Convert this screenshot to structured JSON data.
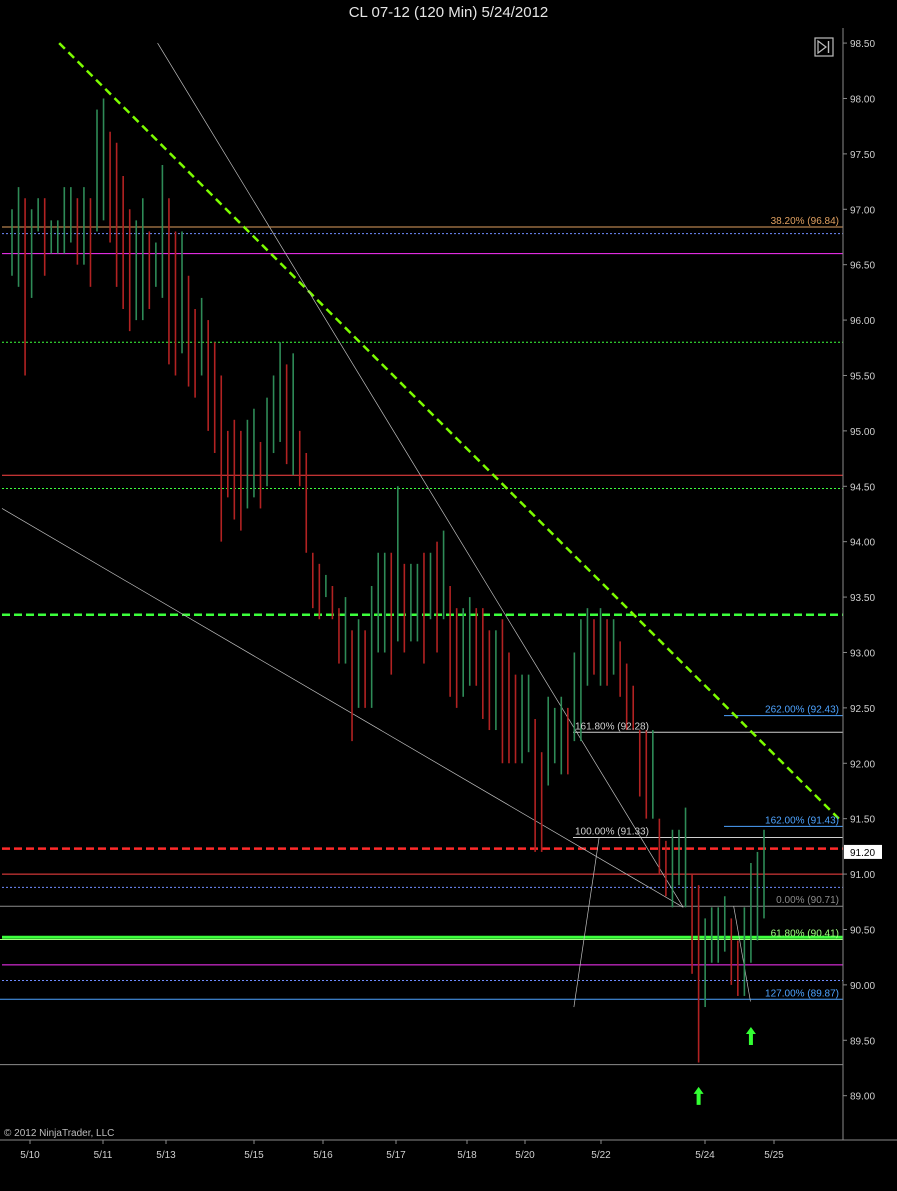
{
  "window": {
    "title": "CL 07-12 (120 Min)  5/24/2012",
    "copyright": "© 2012 NinjaTrader, LLC"
  },
  "colors": {
    "background": "#000000",
    "up_bar": "#2e8b57",
    "down_bar": "#b22222",
    "axis_text": "#cfcfcf",
    "grid": "#3a3a3a",
    "trend_green": "#7cfc00",
    "trend_gray": "#bfbfbf",
    "support_red": "#ff2a2a",
    "support_green": "#3cff3c",
    "fib_blue": "#4da3ff",
    "fib_orange": "#e0a060",
    "fib_white": "#d0d0d0",
    "fib_green": "#a0ff80",
    "magenta": "#ff33ff",
    "arrow_green": "#33ff33",
    "price_label_bg": "#ffffff"
  },
  "chart_data": {
    "type": "ohlc",
    "title": "CL 07-12 (120 Min)  5/24/2012",
    "xlabel": "",
    "ylabel": "",
    "ylim": [
      88.6,
      98.6
    ],
    "y_ticks": [
      "98.50",
      "98.00",
      "97.50",
      "97.00",
      "96.50",
      "96.00",
      "95.50",
      "95.00",
      "94.50",
      "94.00",
      "93.50",
      "93.00",
      "92.50",
      "92.00",
      "91.50",
      "91.00",
      "90.50",
      "90.00",
      "89.50",
      "89.00"
    ],
    "x_ticks": [
      "5/10",
      "5/11",
      "5/13",
      "5/15",
      "5/16",
      "5/17",
      "5/18",
      "5/20",
      "5/22",
      "5/24",
      "5/25"
    ],
    "last_price": "91.20",
    "grid": false,
    "bars": {
      "lows": [
        96.4,
        96.3,
        95.5,
        96.2,
        96.8,
        96.4,
        96.6,
        96.6,
        96.6,
        96.7,
        96.5,
        96.5,
        96.3,
        96.8,
        96.9,
        96.7,
        96.3,
        96.1,
        95.9,
        96.0,
        96.0,
        96.1,
        96.3,
        96.2,
        95.6,
        95.5,
        95.7,
        95.4,
        95.3,
        95.5,
        95.0,
        94.8,
        94.0,
        94.4,
        94.2,
        94.1,
        94.3,
        94.4,
        94.3,
        94.5,
        94.8,
        94.9,
        94.7,
        94.6,
        94.5,
        93.9,
        93.4,
        93.3,
        93.5,
        93.3,
        92.9,
        92.9,
        92.2,
        92.5,
        92.5,
        92.5,
        93.0,
        93.0,
        92.8,
        93.1,
        93.0,
        93.1,
        93.1,
        92.9,
        93.3,
        93.0,
        93.3,
        92.6,
        92.5,
        92.6,
        92.7,
        92.7,
        92.4,
        92.3,
        92.3,
        92.0,
        92.0,
        92.0,
        92.0,
        92.1,
        91.2,
        91.2,
        91.8,
        92.0,
        91.9,
        91.9,
        92.2,
        92.2,
        92.7,
        92.8,
        92.7,
        92.7,
        92.8,
        92.6,
        92.3,
        92.3,
        92.3,
        92.3,
        92.3,
        91.0,
        90.8,
        90.7,
        90.9,
        90.7,
        90.1,
        89.3,
        89.8,
        90.2,
        90.2,
        90.3,
        90.0,
        89.9,
        89.9,
        90.2,
        90.4,
        90.6
      ],
      "highs": [
        97.0,
        97.2,
        97.1,
        97.0,
        97.1,
        97.1,
        96.9,
        96.9,
        97.2,
        97.2,
        97.1,
        97.2,
        97.1,
        97.9,
        98.0,
        97.7,
        97.6,
        97.3,
        97.0,
        96.9,
        97.1,
        96.8,
        96.7,
        97.4,
        97.1,
        96.8,
        96.8,
        96.4,
        96.1,
        96.2,
        96.0,
        95.8,
        95.5,
        95.0,
        95.1,
        95.0,
        95.1,
        95.2,
        94.9,
        95.3,
        95.5,
        95.8,
        95.6,
        95.7,
        95.0,
        94.8,
        93.9,
        93.8,
        93.7,
        93.6,
        93.4,
        93.5,
        93.2,
        93.3,
        93.2,
        93.6,
        93.9,
        93.9,
        93.9,
        94.5,
        93.8,
        93.8,
        93.8,
        93.9,
        93.9,
        94.0,
        94.1,
        93.6,
        93.4,
        93.4,
        93.5,
        93.4,
        93.4,
        93.2,
        93.2,
        93.3,
        93.0,
        92.8,
        92.8,
        92.8,
        92.4,
        92.1,
        92.6,
        92.5,
        92.6,
        92.5,
        93.0,
        93.3,
        93.4,
        93.3,
        93.4,
        93.3,
        93.3,
        93.1,
        92.9,
        92.7,
        91.7,
        91.5,
        91.5,
        91.5,
        91.3,
        91.4,
        91.4,
        91.6,
        91.0,
        90.9,
        90.6,
        90.7,
        90.7,
        90.8,
        90.6,
        90.4,
        90.7,
        91.1,
        91.2,
        91.4
      ]
    },
    "lines": [
      {
        "type": "trend",
        "style": "dash-green",
        "from": [
          0.068,
          98.5
        ],
        "to": [
          0.995,
          91.5
        ]
      },
      {
        "type": "trend",
        "style": "thin-gray",
        "from": [
          0.185,
          98.5
        ],
        "to": [
          0.81,
          90.7
        ]
      },
      {
        "type": "trend",
        "style": "thin-gray",
        "from": [
          0.0,
          94.3
        ],
        "to": [
          0.81,
          90.7
        ]
      },
      {
        "type": "fib-leg",
        "style": "thin-gray",
        "from": [
          0.68,
          89.8
        ],
        "to": [
          0.71,
          91.33
        ]
      },
      {
        "type": "fib-leg",
        "style": "thin-gray",
        "from": [
          0.87,
          90.71
        ],
        "to": [
          0.89,
          89.85
        ]
      }
    ],
    "horizontal_levels": [
      {
        "price": 96.84,
        "color": "#e0a060",
        "style": "solid",
        "label": "38.20% (96.84)"
      },
      {
        "price": 96.78,
        "color": "#6f8cff",
        "style": "dotted",
        "label": ""
      },
      {
        "price": 96.6,
        "color": "#ff33ff",
        "style": "solid",
        "label": ""
      },
      {
        "price": 95.8,
        "color": "#3cff3c",
        "style": "dotted",
        "label": ""
      },
      {
        "price": 94.6,
        "color": "#ff4444",
        "style": "solid",
        "label": ""
      },
      {
        "price": 94.48,
        "color": "#3cff3c",
        "style": "dotted",
        "label": ""
      },
      {
        "price": 93.34,
        "color": "#3cff3c",
        "style": "dashed-bold",
        "label": ""
      },
      {
        "price": 92.43,
        "color": "#4da3ff",
        "style": "solid",
        "label": "262.00% (92.43)"
      },
      {
        "price": 92.28,
        "color": "#d0d0d0",
        "style": "solid",
        "label": "161.80% (92.28)"
      },
      {
        "price": 91.43,
        "color": "#4da3ff",
        "style": "solid",
        "label": "162.00% (91.43)"
      },
      {
        "price": 91.33,
        "color": "#d0d0d0",
        "style": "solid",
        "label": "100.00% (91.33)"
      },
      {
        "price": 91.23,
        "color": "#ff2a2a",
        "style": "dashed-bold",
        "label": ""
      },
      {
        "price": 91.0,
        "color": "#ff4444",
        "style": "solid",
        "label": ""
      },
      {
        "price": 90.88,
        "color": "#6f8cff",
        "style": "dotted",
        "label": ""
      },
      {
        "price": 90.71,
        "color": "#8c8c8c",
        "style": "solid",
        "label": "0.00% (90.71)"
      },
      {
        "price": 90.43,
        "color": "#3cff3c",
        "style": "solid-bold",
        "label": ""
      },
      {
        "price": 90.41,
        "color": "#a0ff80",
        "style": "solid",
        "label": "61.80% (90.41)"
      },
      {
        "price": 90.18,
        "color": "#ff33ff",
        "style": "solid",
        "label": ""
      },
      {
        "price": 90.04,
        "color": "#6f8cff",
        "style": "dotted",
        "label": ""
      },
      {
        "price": 89.87,
        "color": "#4da3ff",
        "style": "solid",
        "label": "127.00% (89.87)"
      },
      {
        "price": 89.28,
        "color": "#8c8c8c",
        "style": "solid",
        "label": ""
      }
    ],
    "arrows": [
      {
        "index": 105,
        "price": 89.08
      },
      {
        "index": 113,
        "price": 89.62
      }
    ]
  }
}
